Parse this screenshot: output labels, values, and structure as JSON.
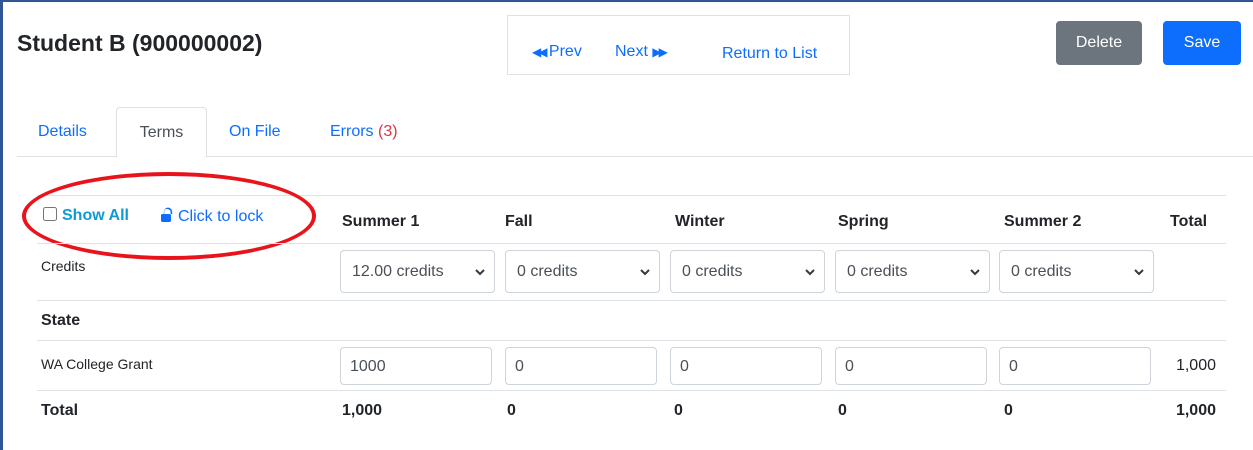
{
  "header": {
    "title": "Student B (900000002)",
    "nav": {
      "prev": "Prev",
      "next": "Next",
      "return": "Return to List"
    },
    "buttons": {
      "delete": "Delete",
      "save": "Save"
    }
  },
  "tabs": [
    {
      "label": "Details"
    },
    {
      "label": "Terms",
      "active": true
    },
    {
      "label": "On File"
    },
    {
      "label": "Errors",
      "count": "(3)"
    }
  ],
  "controls": {
    "show_all": "Show All",
    "lock": "Click to lock"
  },
  "table": {
    "columns": [
      "Summer 1",
      "Fall",
      "Winter",
      "Spring",
      "Summer 2",
      "Total"
    ],
    "credits_label": "Credits",
    "credits": [
      "12.00 credits",
      "0 credits",
      "0 credits",
      "0 credits",
      "0 credits"
    ],
    "section_label": "State",
    "grant": {
      "label": "WA College Grant",
      "values": [
        "1000",
        "0",
        "0",
        "0",
        "0"
      ],
      "total": "1,000"
    },
    "total_label": "Total",
    "totals": [
      "1,000",
      "0",
      "0",
      "0",
      "0",
      "1,000"
    ]
  },
  "colors": {
    "link": "#0d6efd",
    "show_all": "#0d9bd6",
    "error": "#dc3545",
    "annotation": "#e8131b",
    "delete_btn": "#6c757d",
    "save_btn": "#0d6efd"
  }
}
